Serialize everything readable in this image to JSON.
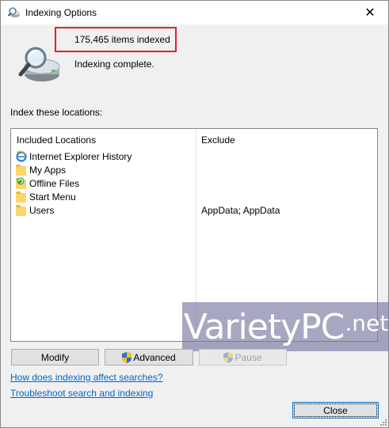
{
  "window": {
    "title": "Indexing Options",
    "close_glyph": "✕"
  },
  "status": {
    "items_indexed": "175,465 items indexed",
    "message": "Indexing complete."
  },
  "locations": {
    "label": "Index these locations:",
    "headers": {
      "included": "Included Locations",
      "exclude": "Exclude"
    },
    "rows": [
      {
        "name": "Internet Explorer History",
        "exclude": "",
        "icon": "ie-icon"
      },
      {
        "name": "My Apps",
        "exclude": "",
        "icon": "folder-icon"
      },
      {
        "name": "Offline Files",
        "exclude": "",
        "icon": "offline-files-icon"
      },
      {
        "name": "Start Menu",
        "exclude": "",
        "icon": "folder-icon"
      },
      {
        "name": "Users",
        "exclude": "AppData; AppData",
        "icon": "folder-icon"
      }
    ]
  },
  "buttons": {
    "modify": "Modify",
    "advanced": "Advanced",
    "pause": "Pause",
    "close": "Close"
  },
  "links": {
    "how": "How does indexing affect searches?",
    "troubleshoot": "Troubleshoot search and indexing"
  },
  "watermark": {
    "main": "VarietyPC",
    "suffix": ".net"
  },
  "colors": {
    "highlight_box": "#e0202a",
    "link": "#0066cc",
    "focus_border": "#0078d7"
  }
}
